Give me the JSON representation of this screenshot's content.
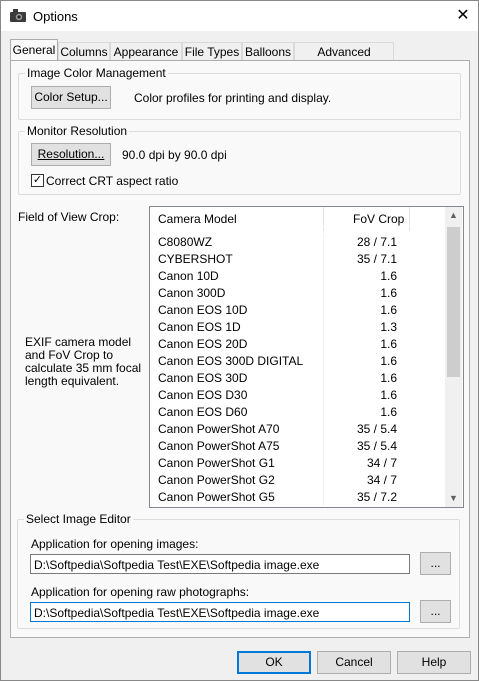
{
  "window": {
    "title": "Options",
    "close_glyph": "✕"
  },
  "tabs": [
    {
      "label": "General"
    },
    {
      "label": "Columns"
    },
    {
      "label": "Appearance"
    },
    {
      "label": "File Types"
    },
    {
      "label": "Balloons"
    },
    {
      "label": "Advanced Settings"
    }
  ],
  "color_mgmt": {
    "group_label": "Image Color Management",
    "button_label": "Color Setup...",
    "description": "Color profiles for printing and display."
  },
  "monitor": {
    "group_label": "Monitor Resolution",
    "button_label": "Resolution...",
    "resolution_text": "90.0 dpi by 90.0 dpi",
    "checkbox_label": "Correct CRT aspect ratio",
    "checkbox_checked": true,
    "check_glyph": "✓"
  },
  "fov": {
    "label": "Field of View Crop:",
    "description": "EXIF camera model and FoV Crop to calculate 35 mm focal length equivalent.",
    "columns": {
      "model": "Camera Model",
      "fov": "FoV Crop"
    },
    "rows": [
      {
        "model": "C8080WZ",
        "fov": "28 / 7.1"
      },
      {
        "model": "CYBERSHOT",
        "fov": "35 / 7.1"
      },
      {
        "model": "Canon 10D",
        "fov": "1.6"
      },
      {
        "model": "Canon 300D",
        "fov": "1.6"
      },
      {
        "model": "Canon EOS 10D",
        "fov": "1.6"
      },
      {
        "model": "Canon EOS 1D",
        "fov": "1.3"
      },
      {
        "model": "Canon EOS 20D",
        "fov": "1.6"
      },
      {
        "model": "Canon EOS 300D DIGITAL",
        "fov": "1.6"
      },
      {
        "model": "Canon EOS 30D",
        "fov": "1.6"
      },
      {
        "model": "Canon EOS D30",
        "fov": "1.6"
      },
      {
        "model": "Canon EOS D60",
        "fov": "1.6"
      },
      {
        "model": "Canon PowerShot A70",
        "fov": "35 / 5.4"
      },
      {
        "model": "Canon PowerShot A75",
        "fov": "35 / 5.4"
      },
      {
        "model": "Canon PowerShot G1",
        "fov": "34 / 7"
      },
      {
        "model": "Canon PowerShot G2",
        "fov": "34 / 7"
      },
      {
        "model": "Canon PowerShot G5",
        "fov": "35 / 7.2"
      }
    ],
    "scroll_up_glyph": "▲",
    "scroll_down_glyph": "▼"
  },
  "editor": {
    "group_label": "Select Image Editor",
    "images_label": "Application for opening images:",
    "images_value": "D:\\Softpedia\\Softpedia Test\\EXE\\Softpedia image.exe",
    "images_browse": "...",
    "raw_label": "Application for opening raw photographs:",
    "raw_value": "D:\\Softpedia\\Softpedia Test\\EXE\\Softpedia image.exe",
    "raw_browse": "..."
  },
  "footer": {
    "ok": "OK",
    "cancel": "Cancel",
    "help": "Help"
  }
}
